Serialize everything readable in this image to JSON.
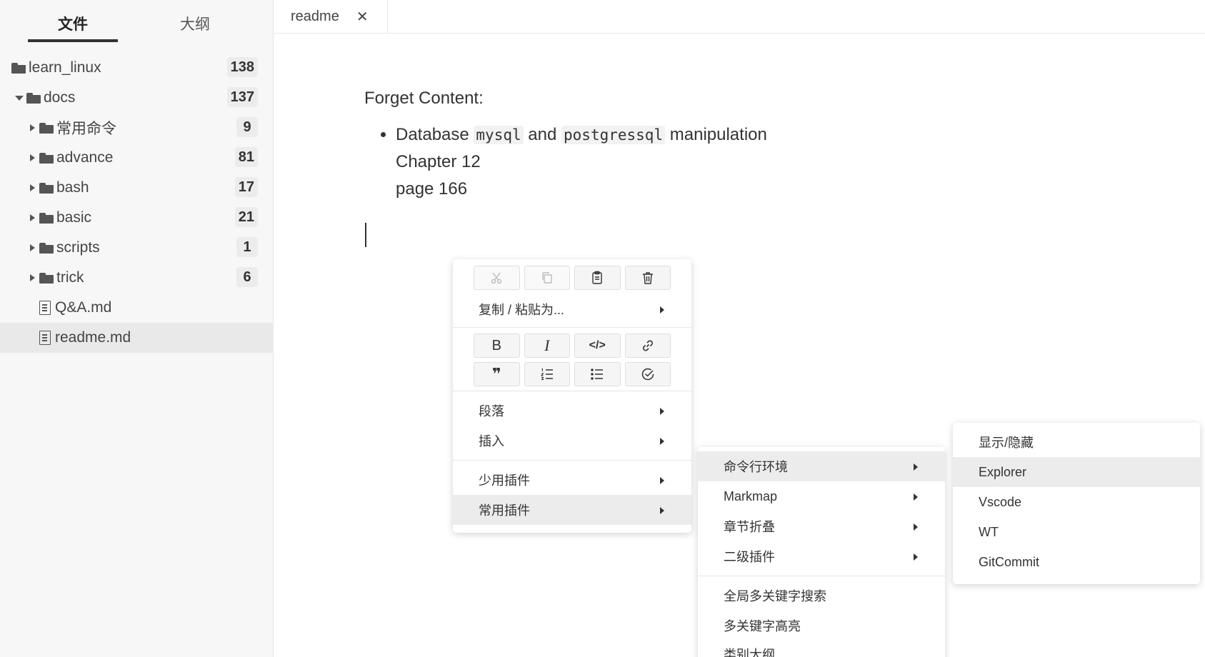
{
  "sidebar": {
    "tabs": [
      {
        "label": "文件",
        "active": true
      },
      {
        "label": "大纲",
        "active": false
      }
    ],
    "tree": [
      {
        "name": "learn_linux",
        "type": "folder",
        "count": "138",
        "indent": 0,
        "caret": "none"
      },
      {
        "name": "docs",
        "type": "folder",
        "count": "137",
        "indent": 1,
        "caret": "down"
      },
      {
        "name": "常用命令",
        "type": "folder",
        "count": "9",
        "indent": 2,
        "caret": "right"
      },
      {
        "name": "advance",
        "type": "folder",
        "count": "81",
        "indent": 2,
        "caret": "right"
      },
      {
        "name": "bash",
        "type": "folder",
        "count": "17",
        "indent": 2,
        "caret": "right"
      },
      {
        "name": "basic",
        "type": "folder",
        "count": "21",
        "indent": 2,
        "caret": "right"
      },
      {
        "name": "scripts",
        "type": "folder",
        "count": "1",
        "indent": 2,
        "caret": "right"
      },
      {
        "name": "trick",
        "type": "folder",
        "count": "6",
        "indent": 2,
        "caret": "right"
      },
      {
        "name": "Q&A.md",
        "type": "file",
        "indent": 2,
        "caret": "none"
      },
      {
        "name": "readme.md",
        "type": "file",
        "indent": 2,
        "caret": "none",
        "selected": true
      }
    ]
  },
  "editor": {
    "tab": {
      "title": "readme",
      "close": "✕"
    },
    "heading": "Forget Content:",
    "bullet": {
      "pre": "Database ",
      "code1": "mysql",
      "mid": " and ",
      "code2": "postgressql",
      "post": " manipulation",
      "line2": "Chapter 12",
      "line3": "page 166"
    }
  },
  "context_menu": {
    "icon_rows": [
      [
        {
          "name": "cut",
          "disabled": true
        },
        {
          "name": "copy",
          "disabled": true
        },
        {
          "name": "paste",
          "disabled": false
        },
        {
          "name": "delete",
          "disabled": false
        }
      ],
      [
        {
          "name": "bold",
          "label": "B"
        },
        {
          "name": "italic",
          "label": "I"
        },
        {
          "name": "code",
          "label": "</>"
        },
        {
          "name": "link"
        }
      ],
      [
        {
          "name": "quote",
          "label": "❞"
        },
        {
          "name": "ordered-list"
        },
        {
          "name": "unordered-list"
        },
        {
          "name": "task-list"
        }
      ]
    ],
    "copy_paste_as": "复制 / 粘贴为...",
    "paragraph": "段落",
    "insert": "插入",
    "rare_plugins": "少用插件",
    "common_plugins": "常用插件"
  },
  "submenu_plugins": {
    "items": [
      "命令行环境",
      "Markmap",
      "章节折叠",
      "二级插件"
    ],
    "items2": [
      "全局多关键字搜索",
      "多关键字高亮",
      "类别大纲"
    ]
  },
  "submenu_cmd": {
    "items": [
      "显示/隐藏",
      "Explorer",
      "Vscode",
      "WT",
      "GitCommit"
    ]
  }
}
